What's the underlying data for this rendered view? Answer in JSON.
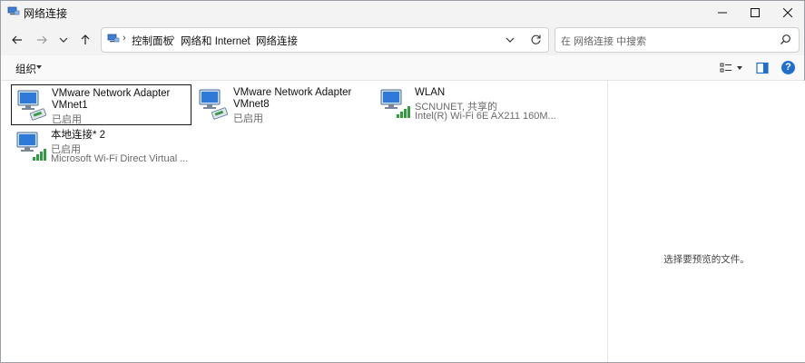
{
  "window": {
    "title": "网络连接",
    "controls": [
      "minimize-icon",
      "maximize-icon",
      "close-icon"
    ]
  },
  "nav": {
    "breadcrumb": [
      "控制面板",
      "网络和 Internet",
      "网络连接"
    ],
    "search_placeholder": "在 网络连接 中搜索"
  },
  "toolbar": {
    "organize_label": "组织"
  },
  "connections": [
    {
      "name_line1": "VMware Network Adapter",
      "name_line2": "VMnet1",
      "status": "已启用",
      "device": "",
      "icon": "wired-adapter-icon",
      "selected": true
    },
    {
      "name_line1": "VMware Network Adapter",
      "name_line2": "VMnet8",
      "status": "已启用",
      "device": "",
      "icon": "wired-adapter-icon",
      "selected": false
    },
    {
      "name_line1": "WLAN",
      "name_line2": "",
      "status": "SCNUNET, 共享的",
      "device": "Intel(R) Wi-Fi 6E AX211 160M...",
      "icon": "wifi-adapter-icon",
      "selected": false
    },
    {
      "name_line1": "本地连接* 2",
      "name_line2": "",
      "status": "已启用",
      "device": "Microsoft Wi-Fi Direct Virtual ...",
      "icon": "wifi-adapter-icon",
      "selected": false
    }
  ],
  "preview": {
    "empty_text": "选择要预览的文件。"
  },
  "colors": {
    "accent": "#1f6fd1",
    "signal": "#2e9e3e",
    "chrome": "#f3f3f3"
  }
}
